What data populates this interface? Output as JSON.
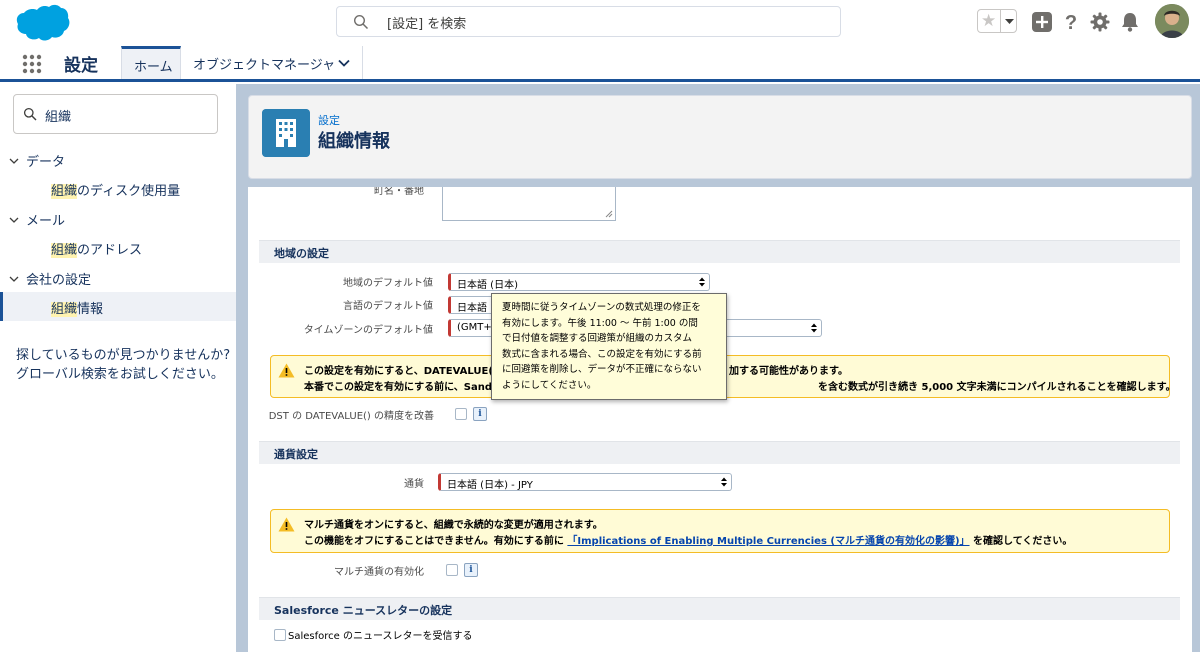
{
  "header": {
    "search_placeholder": "[設定] を検索"
  },
  "nav": {
    "app_name": "設定",
    "tabs": [
      {
        "label": "ホーム",
        "active": true
      },
      {
        "label": "オブジェクトマネージャ",
        "active": false
      }
    ]
  },
  "sidebar": {
    "quick_find": "組織",
    "groups": [
      {
        "label": "データ",
        "items": [
          {
            "highlight": "組織",
            "rest": "のディスク使用量"
          }
        ]
      },
      {
        "label": "メール",
        "items": [
          {
            "highlight": "組織",
            "rest": "のアドレス"
          }
        ]
      },
      {
        "label": "会社の設定",
        "items": [
          {
            "highlight": "組織",
            "rest": "情報"
          }
        ]
      }
    ],
    "no_match_line1": "探しているものが見つかりませんか?",
    "no_match_line2": "グローバル検索をお試しください。"
  },
  "page": {
    "breadcrumb": "設定",
    "title": "組織情報"
  },
  "form": {
    "street_label": "町名・番地",
    "locale_section": "地域の設定",
    "locale_label": "地域のデフォルト値",
    "locale_value": "日本語 (日本)",
    "language_label": "言語のデフォルト値",
    "language_value": "日本語",
    "timezone_label": "タイムゾーンのデフォルト値",
    "timezone_value": "(GMT+",
    "warn1_line1": "この設定を有効にすると、DATEVALUE()",
    "warn1_line1_tail": "加する可能性があります。",
    "warn1_line2": "本番でこの設定を有効にする前に、Sandb",
    "warn1_line2_tail": "を含む数式が引き続き 5,000 文字未満にコンパイルされることを確認します。",
    "dst_label": "DST の DATEVALUE() の精度を改善",
    "currency_section": "通貨設定",
    "currency_label": "通貨",
    "currency_value": "日本語 (日本) - JPY",
    "warn2_line1": "マルチ通貨をオンにすると、組織で永続的な変更が適用されます。",
    "warn2_line2_pre": "この機能をオフにすることはできません。有効にする前に ",
    "warn2_link": "「Implications of Enabling Multiple Currencies (マルチ通貨の有効化の影響)」",
    "warn2_line2_post": "を確認してください。",
    "multi_currency_label": "マルチ通貨の有効化",
    "newsletter_section": "Salesforce ニュースレターの設定",
    "newsletter_label": "Salesforce のニュースレターを受信する"
  },
  "tooltip": {
    "lines": [
      "夏時間に従うタイムゾーンの数式処理の修正を",
      "有効にします。午後 11:00 〜 午前 1:00 の間",
      "で日付値を調整する回避策が組織のカスタム",
      "数式に含まれる場合、この設定を有効にする前",
      "に回避策を削除し、データが不正確にならない",
      "ようにしてください。"
    ]
  },
  "colors": {
    "brand_blue": "#1b5297",
    "salesforce_cloud": "#00a1e0",
    "required_red": "#c23934",
    "warning_yellow": "#f4bc25"
  }
}
